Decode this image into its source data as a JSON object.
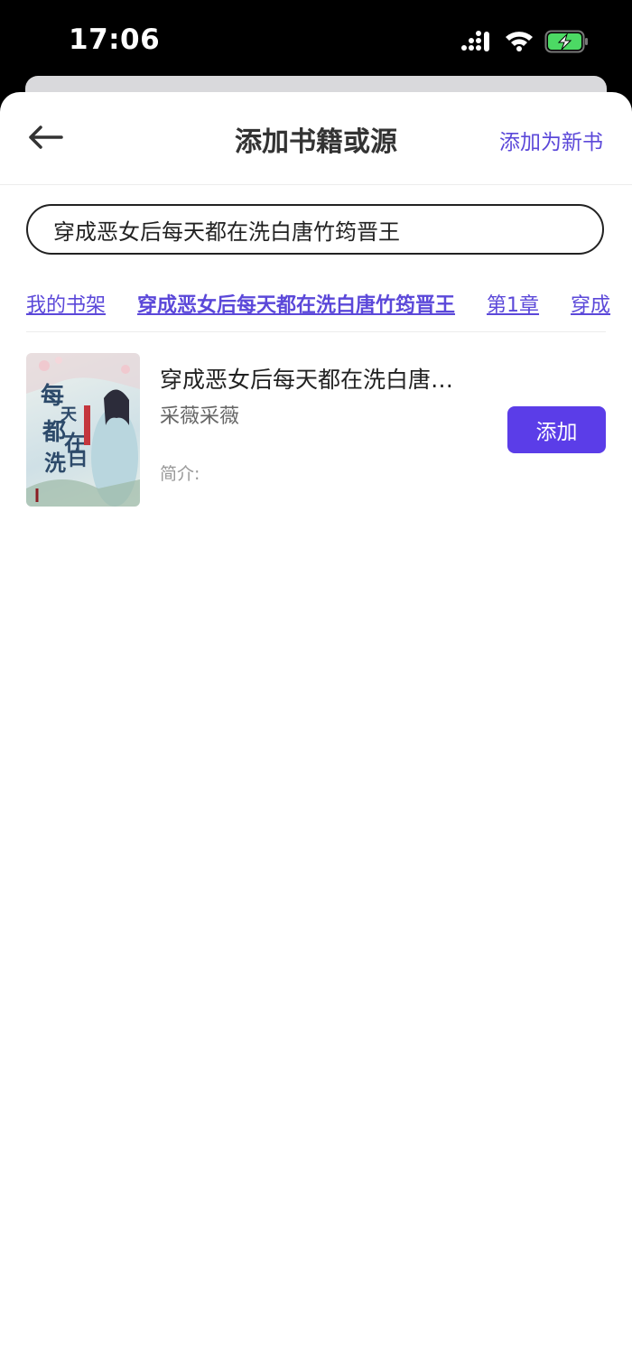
{
  "status": {
    "time": "17:06"
  },
  "header": {
    "title": "添加书籍或源",
    "add_new_label": "添加为新书"
  },
  "search": {
    "value": "穿成恶女后每天都在洗白唐竹筠晋王"
  },
  "breadcrumbs": [
    {
      "label": "我的书架"
    },
    {
      "label": "穿成恶女后每天都在洗白唐竹筠晋王"
    },
    {
      "label": "第1章"
    },
    {
      "label": "穿成"
    }
  ],
  "book": {
    "title": "穿成恶女后每天都在洗白唐…",
    "author": "采薇采薇",
    "intro_label": "简介:",
    "cover_text": "每天都在洗白",
    "add_label": "添加"
  },
  "colors": {
    "accent": "#5b3de8",
    "link": "#5b48d9",
    "battery": "#4cd964"
  }
}
